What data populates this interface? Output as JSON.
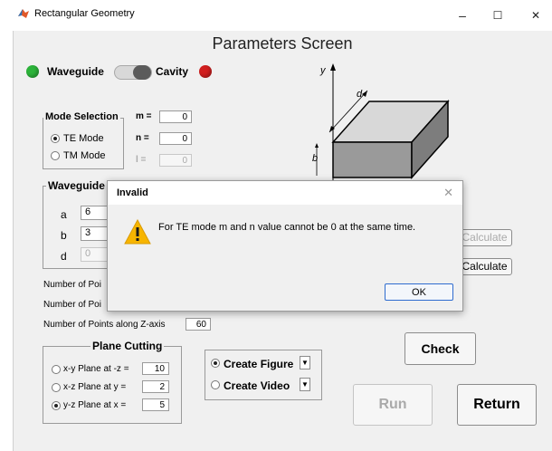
{
  "window": {
    "title": "Rectangular Geometry",
    "minimize_label": "–",
    "maximize_label": "☐",
    "close_label": "✕",
    "icon": "matlab-icon"
  },
  "screen": {
    "heading": "Parameters Screen",
    "waveguide_label": "Waveguide",
    "cavity_label": "Cavity",
    "waveguide_lamp_color": "#2cb33a",
    "cavity_lamp_color": "#d11f1f"
  },
  "mode_selection": {
    "title": "Mode Selection",
    "options": [
      "TE Mode",
      "TM Mode"
    ],
    "selected": "TE Mode",
    "m_label": "m =",
    "m_value": "0",
    "n_label": "n =",
    "n_value": "0",
    "l_label": "l =",
    "l_value": "0"
  },
  "waveguide_panel": {
    "title": "Waveguide d",
    "a_label": "a",
    "a_value": "6",
    "b_label": "b",
    "b_value": "3",
    "d_label": "d",
    "d_value": "0"
  },
  "points": {
    "x_label": "Number of Poi",
    "y_label": "Number of Poi",
    "z_label": "Number of Points along Z-axis",
    "z_value": "60"
  },
  "plane_cutting": {
    "title": "Plane Cutting",
    "options": [
      {
        "label": "x-y Plane at -z =",
        "value": "10"
      },
      {
        "label": "x-z Plane at y =",
        "value": "2"
      },
      {
        "label": "y-z Plane at x =",
        "value": "5"
      }
    ],
    "selected_index": 2
  },
  "output": {
    "create_figure": "Create Figure",
    "create_video": "Create Video",
    "selected": "Create Figure"
  },
  "buttons": {
    "calculate_disabled": "Calculate",
    "calculate": "Calculate",
    "check": "Check",
    "run": "Run",
    "return": "Return"
  },
  "diagram": {
    "y_label": "y",
    "d_label": "d",
    "b_label": "b"
  },
  "dialog": {
    "title": "Invalid",
    "close_label": "✕",
    "message": "For TE mode m and n value cannot be 0 at the same time.",
    "icon": "warning-icon",
    "ok_label": "OK"
  }
}
